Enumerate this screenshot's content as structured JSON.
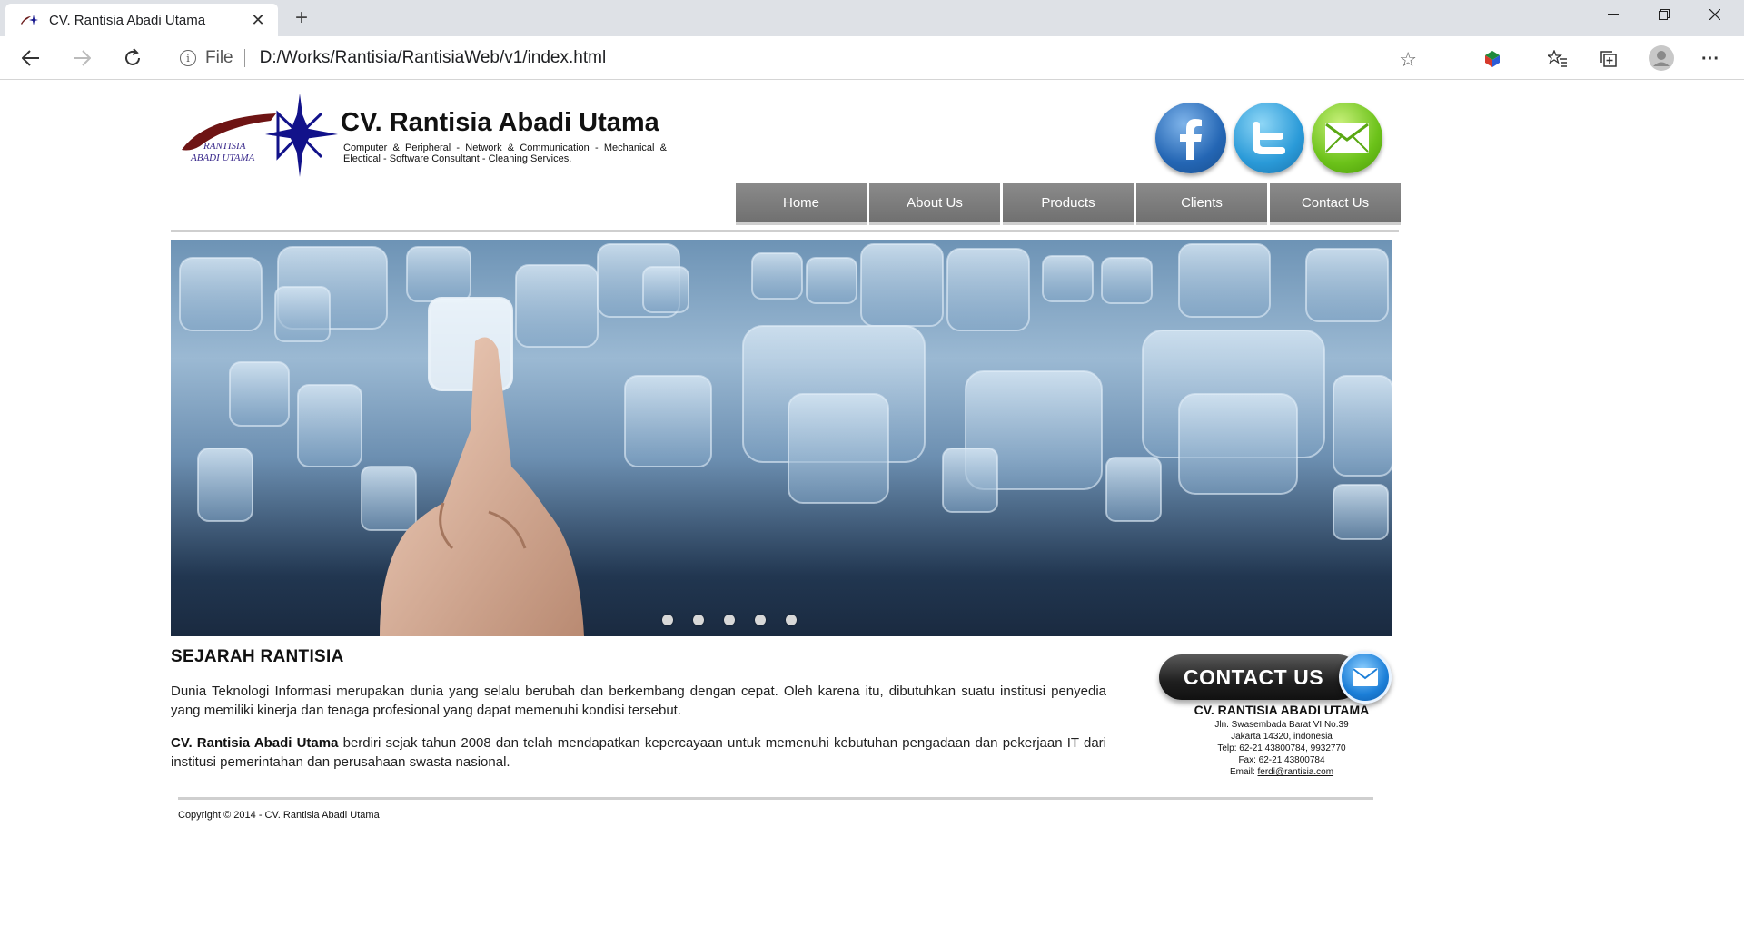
{
  "browser": {
    "tab_title": "CV. Rantisia Abadi Utama",
    "tab_close": "✕",
    "new_tab": "+",
    "window_minimize": "—",
    "window_restore": "❐",
    "window_close": "✕",
    "omnibox_info": "i",
    "omnibox_scheme": "File",
    "url": "D:/Works/Rantisia/RantisiaWeb/v1/index.html",
    "star": "☆",
    "favorites": "☆≡",
    "collections": "⧉",
    "more": "···"
  },
  "header": {
    "logo_text_line1": "RANTISIA",
    "logo_text_line2": "ABADI UTAMA",
    "company_name": "CV. Rantisia Abadi Utama",
    "tagline": "Computer & Peripheral - Network & Communication - Mechanical & Electical - Software Consultant - Cleaning Services."
  },
  "social": {
    "facebook": "facebook-icon",
    "twitter": "twitter-icon",
    "email": "email-icon"
  },
  "menu": {
    "items": [
      {
        "label": "Home"
      },
      {
        "label": "About Us"
      },
      {
        "label": "Products"
      },
      {
        "label": "Clients"
      },
      {
        "label": "Contact Us"
      }
    ]
  },
  "slider": {
    "slides": 5,
    "active": 1
  },
  "main": {
    "title": "SEJARAH RANTISIA",
    "para1": "Dunia Teknologi Informasi merupakan dunia yang selalu berubah dan berkembang dengan cepat. Oleh karena itu, dibutuhkan suatu institusi penyedia yang memiliki kinerja dan tenaga profesional yang dapat memenuhi kondisi tersebut.",
    "para2_bold": "CV. Rantisia Abadi Utama",
    "para2_rest": " berdiri sejak tahun 2008 dan telah mendapatkan kepercayaan untuk memenuhi kebutuhan pengadaan dan pekerjaan IT dari institusi pemerintahan dan perusahaan swasta nasional."
  },
  "contact": {
    "banner_label": "CONTACT US",
    "name": "CV. RANTISIA ABADI UTAMA",
    "address1": "Jln. Swasembada Barat VI No.39",
    "address2": "Jakarta 14320, indonesia",
    "phone": "Telp: 62-21 43800784, 9932770",
    "fax": "Fax: 62-21 43800784",
    "email_label": "Email: ",
    "email": "ferdi@rantisia.com"
  },
  "footer": {
    "copyright": "Copyright © 2014 - CV. Rantisia Abadi Utama"
  },
  "colors": {
    "menu_bg": "#7d7d7d",
    "rule": "#cfcfcf",
    "facebook": "#2466b4",
    "twitter": "#2a9ad8",
    "email": "#6cc21a"
  }
}
